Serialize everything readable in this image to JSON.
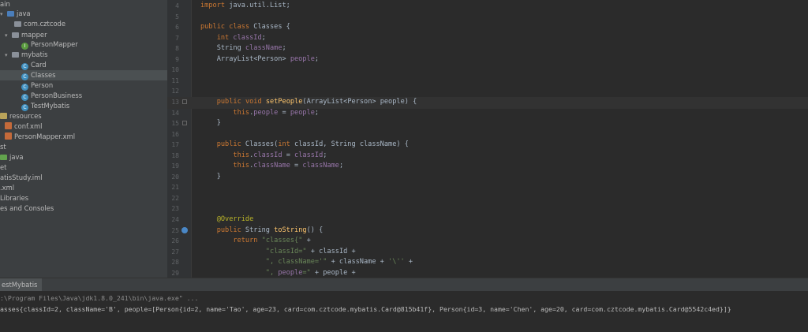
{
  "project_tree": [
    {
      "label": "ain",
      "icon": "none",
      "arrow": ""
    },
    {
      "label": "java",
      "icon": "folder-blue",
      "arrow": "▾"
    },
    {
      "label": "com.cztcode",
      "icon": "package",
      "arrow": ""
    },
    {
      "label": "mapper",
      "icon": "package",
      "arrow": "▾"
    },
    {
      "label": "PersonMapper",
      "icon": "interface",
      "arrow": ""
    },
    {
      "label": "mybatis",
      "icon": "package",
      "arrow": "▾"
    },
    {
      "label": "Card",
      "icon": "class",
      "arrow": ""
    },
    {
      "label": "Classes",
      "icon": "class",
      "arrow": "",
      "selected": true
    },
    {
      "label": "Person",
      "icon": "class",
      "arrow": ""
    },
    {
      "label": "PersonBusiness",
      "icon": "class",
      "arrow": ""
    },
    {
      "label": "TestMybatis",
      "icon": "class",
      "arrow": ""
    },
    {
      "label": "resources",
      "icon": "resources",
      "arrow": ""
    },
    {
      "label": "conf.xml",
      "icon": "xml",
      "arrow": ""
    },
    {
      "label": "PersonMapper.xml",
      "icon": "xml",
      "arrow": ""
    },
    {
      "label": "st",
      "icon": "none",
      "arrow": ""
    },
    {
      "label": "java",
      "icon": "folder-green",
      "arrow": ""
    },
    {
      "label": "et",
      "icon": "none",
      "arrow": ""
    },
    {
      "label": "atisStudy.iml",
      "icon": "none",
      "arrow": ""
    },
    {
      "label": ".xml",
      "icon": "none",
      "arrow": ""
    },
    {
      "label": "Libraries",
      "icon": "none",
      "arrow": ""
    },
    {
      "label": "es and Consoles",
      "icon": "none",
      "arrow": ""
    }
  ],
  "editor": {
    "line_numbers": [
      "4",
      "5",
      "6",
      "7",
      "8",
      "9",
      "10",
      "11",
      "12",
      "13",
      "14",
      "15",
      "16",
      "17",
      "18",
      "19",
      "20",
      "21",
      "22",
      "23",
      "24",
      "25",
      "26",
      "27",
      "28",
      "29"
    ],
    "lines": [
      "import java.util.List;",
      "",
      "public class Classes {",
      "    int classId;",
      "    String className;",
      "    ArrayList<Person> people;",
      "",
      "",
      "",
      "    public void setPeople(ArrayList<Person> people) {",
      "        this.people = people;",
      "    }",
      "",
      "    public Classes(int classId, String className) {",
      "        this.classId = classId;",
      "        this.className = className;",
      "    }",
      "",
      "",
      "",
      "    @Override",
      "    public String toString() {",
      "        return \"classes{\" +",
      "                \"classId=\" + classId +",
      "                \", className='\" + className + '\\'' +",
      "                \", people=\" + people +"
    ]
  },
  "run_panel": {
    "tab_label": "estMybatis",
    "console_lines": [
      ":\\Program Files\\Java\\jdk1.8.0_241\\bin\\java.exe\" ...",
      "asses{classId=2, className='B', people=[Person{id=2, name='Tao', age=23, card=com.cztcode.mybatis.Card@815b41f}, Person{id=3, name='Chen', age=20, card=com.cztcode.mybatis.Card@5542c4ed}]}"
    ]
  },
  "colors": {
    "keyword": "#cc7832",
    "field": "#9876aa",
    "method": "#ffc66d",
    "string": "#6a8759",
    "annotation": "#bbb529",
    "background": "#2b2b2b",
    "sidebar": "#3c3f41"
  }
}
